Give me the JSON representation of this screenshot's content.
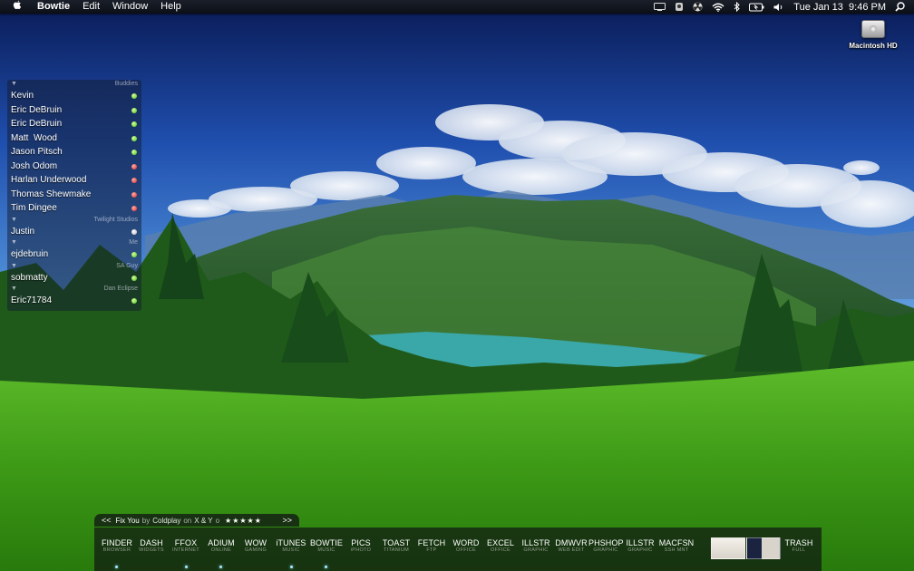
{
  "menubar": {
    "apple_icon": "apple-icon",
    "app_name": "Bowtie",
    "menus": [
      "Edit",
      "Window",
      "Help"
    ],
    "clock": "Tue Jan 13  9:46 PM",
    "status_icons": [
      "display-icon",
      "user-icon",
      "radioactive-icon",
      "wifi-icon",
      "bluetooth-icon",
      "battery-icon",
      "volume-icon",
      "spotlight-icon"
    ]
  },
  "desktop": {
    "hd_label": "Macintosh HD"
  },
  "buddy_list": {
    "groups": [
      {
        "name": "Buddies",
        "buddies": [
          {
            "name": "Kevin",
            "status": "available"
          },
          {
            "name": "Eric DeBruin",
            "status": "available"
          },
          {
            "name": "Eric DeBruin",
            "status": "available"
          },
          {
            "name": "Matt  Wood",
            "status": "available"
          },
          {
            "name": "Jason Pitsch",
            "status": "available"
          },
          {
            "name": "Josh Odom",
            "status": "away"
          },
          {
            "name": "Harlan Underwood",
            "status": "away"
          },
          {
            "name": "Thomas Shewmake",
            "status": "away"
          },
          {
            "name": "Tim Dingee",
            "status": "away"
          }
        ]
      },
      {
        "name": "Twilight Studios",
        "buddies": [
          {
            "name": "Justin",
            "status": "idle"
          }
        ]
      },
      {
        "name": "Me",
        "buddies": [
          {
            "name": "ejdebruin",
            "status": "available"
          }
        ]
      },
      {
        "name": "SA Guy",
        "buddies": [
          {
            "name": "sobmatty",
            "status": "available"
          }
        ]
      },
      {
        "name": "Dan Eclipse",
        "buddies": [
          {
            "name": "Eric71784",
            "status": "available"
          }
        ]
      }
    ]
  },
  "now_playing": {
    "prev_label": "<<",
    "next_label": ">>",
    "song": "Fix You",
    "by_label": "by",
    "artist": "Coldplay",
    "on_label": "on",
    "album": "X & Y",
    "rating_prefix": "o",
    "stars": "★★★★★"
  },
  "dock": {
    "items": [
      {
        "name": "FINDER",
        "sub": "BROWSER",
        "running": true
      },
      {
        "name": "DASH",
        "sub": "WIDGETS",
        "running": false
      },
      {
        "name": "FFOX",
        "sub": "INTERNET",
        "running": true
      },
      {
        "name": "ADIUM",
        "sub": "ONLINE",
        "running": true
      },
      {
        "name": "WOW",
        "sub": "GAMING",
        "running": false
      },
      {
        "name": "iTUNES",
        "sub": "MUSIC",
        "running": true
      },
      {
        "name": "BOWTIE",
        "sub": "MUSIC",
        "running": true
      },
      {
        "name": "PICS",
        "sub": "iPHOTO",
        "running": false
      },
      {
        "name": "TOAST",
        "sub": "TITANIUM",
        "running": false
      },
      {
        "name": "FETCH",
        "sub": "FTP",
        "running": false
      },
      {
        "name": "WORD",
        "sub": "OFFICE",
        "running": false
      },
      {
        "name": "EXCEL",
        "sub": "OFFICE",
        "running": false
      },
      {
        "name": "ILLSTR",
        "sub": "GRAPHIC",
        "running": false
      },
      {
        "name": "DMWVR",
        "sub": "WEB EDIT",
        "running": false
      },
      {
        "name": "PHSHOP",
        "sub": "GRAPHIC",
        "running": false
      },
      {
        "name": "ILLSTR",
        "sub": "GRAPHIC",
        "running": false
      },
      {
        "name": "MACFSN",
        "sub": "SSH MNT",
        "running": false
      }
    ],
    "trash": {
      "name": "TRASH",
      "sub": "FULL"
    }
  }
}
